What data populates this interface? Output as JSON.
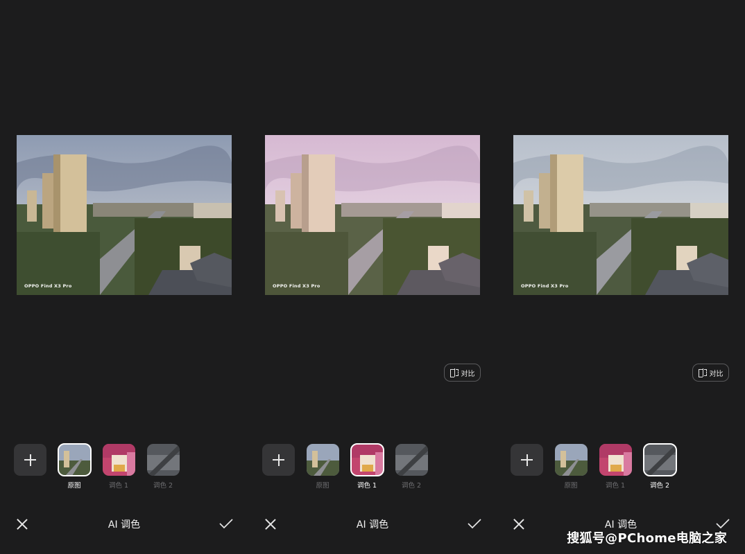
{
  "panels": [
    {
      "camera_watermark": "OPPO Find X3 Pro",
      "sky_color": "#9aa6ba",
      "title": "AI 调色",
      "thumbs": [
        {
          "label": "原图",
          "selected": true
        },
        {
          "label": "调色 1",
          "selected": false
        },
        {
          "label": "调色 2",
          "selected": false
        }
      ]
    },
    {
      "camera_watermark": "OPPO Find X3 Pro",
      "sky_color": "#d8c4d6",
      "title": "AI 调色",
      "compare_label": "对比",
      "thumbs": [
        {
          "label": "原图",
          "selected": false
        },
        {
          "label": "调色 1",
          "selected": true
        },
        {
          "label": "调色 2",
          "selected": false
        }
      ]
    },
    {
      "camera_watermark": "OPPO Find X3 Pro",
      "sky_color": "#c7cdd6",
      "title": "AI 调色",
      "compare_label": "对比",
      "thumbs": [
        {
          "label": "原图",
          "selected": false
        },
        {
          "label": "调色 1",
          "selected": false
        },
        {
          "label": "调色 2",
          "selected": true
        }
      ]
    }
  ],
  "site_watermark": "搜狐号@PChome电脑之家",
  "icons": {
    "add": "plus-icon",
    "close": "close-icon",
    "confirm": "check-icon",
    "compare": "compare-icon"
  }
}
